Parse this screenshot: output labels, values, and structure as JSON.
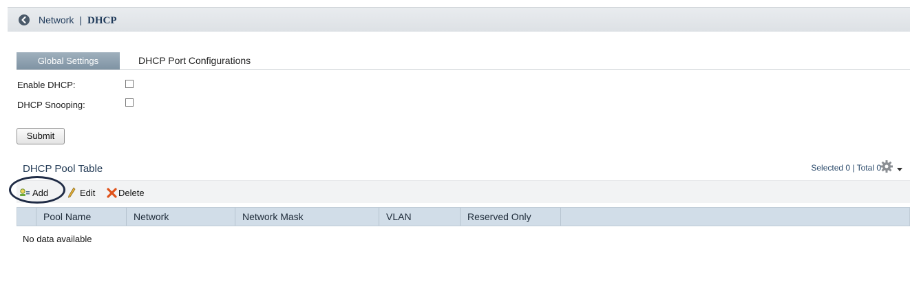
{
  "header": {
    "back_icon": "chevron-left-circle-icon",
    "section": "Network",
    "separator": "|",
    "current": "DHCP"
  },
  "tabs": [
    {
      "label": "Global Settings",
      "active": true
    },
    {
      "label": "DHCP Port Configurations",
      "active": false
    }
  ],
  "settings": {
    "enable_dhcp_label": "Enable DHCP:",
    "enable_dhcp_checked": false,
    "dhcp_snooping_label": "DHCP Snooping:",
    "dhcp_snooping_checked": false,
    "submit_label": "Submit"
  },
  "pool_table": {
    "title": "DHCP Pool Table",
    "stats": "Selected 0 | Total 0",
    "toolbar": {
      "add_label": "Add",
      "edit_label": "Edit",
      "delete_label": "Delete"
    },
    "columns": [
      "Pool Name",
      "Network",
      "Network Mask",
      "VLAN",
      "Reserved Only"
    ],
    "empty_text": "No data available"
  },
  "colors": {
    "accent": "#7f93a3",
    "header_bg": "#e3e7eb",
    "table_header_bg": "#d1dde8",
    "annotation_circle": "#1f2b45",
    "delete_icon": "#e0531b",
    "edit_icon": "#e8b23a"
  }
}
